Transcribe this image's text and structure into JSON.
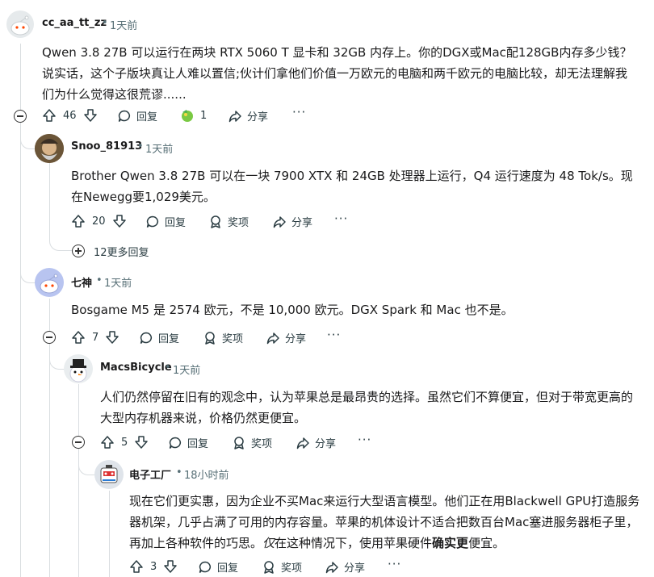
{
  "comments": [
    {
      "username": "cc_aa_tt_zz",
      "time": "1天前",
      "body": "Qwen 3.8 27B 可以运行在两块 RTX 5060 T 显卡和 32GB 内存上。你的DGX或Mac配128GB内存多少钱？说实话，这个子版块真让人难以置信;伙计们拿他们价值一万欧元的电脑和两千欧元的电脑比较，却无法理解我们为什么觉得这很荒谬......",
      "votes": "46",
      "reply": "回复",
      "award_count": "1",
      "share": "分享"
    },
    {
      "username": "Snoo_81913",
      "time": "1天前",
      "body": "Brother Qwen 3.8 27B 可以在一块 7900 XTX 和 24GB 处理器上运行，Q4 运行速度为 48 Tok/s。现在Newegg要1,029美元。",
      "votes": "20",
      "reply": "回复",
      "award": "奖项",
      "share": "分享",
      "more_replies": "12更多回复"
    },
    {
      "username": "七神",
      "time": "1天前",
      "body": "Bosgame M5 是 2574 欧元，不是 10,000 欧元。DGX Spark 和 Mac 也不是。",
      "votes": "7",
      "reply": "回复",
      "award": "奖项",
      "share": "分享"
    },
    {
      "username": "MacsBicycle",
      "time": "1天前",
      "body": "人们仍然停留在旧有的观念中，认为苹果总是最昂贵的选择。虽然它们不算便宜，但对于带宽更高的大型内存机器来说，价格仍然更便宜。",
      "votes": "5",
      "reply": "回复",
      "award": "奖项",
      "share": "分享"
    },
    {
      "username": "电子工厂",
      "time": "18小时前",
      "body_pre": "现在它们更实惠，因为企业不买Mac来运行大型语言模型。他们正在用Blackwell GPU打造服务器机架，几乎占满了可用的内存容量。苹果的机体设计不适合把数百台Mac塞进服务器柜子里，再加上各种软件的巧思。",
      "body_italic": "仅",
      "body_mid": "在这种情况下，使用苹果硬件",
      "body_bold": "确实更",
      "body_post": "便宜。",
      "votes": "3",
      "reply": "回复",
      "award": "奖项",
      "share": "分享"
    }
  ],
  "separator": "•",
  "more_icon": "more-dots-icon",
  "colors": {
    "thread_line": "#d9dde0",
    "text": "#1a1a1b",
    "meta": "#576f76"
  }
}
